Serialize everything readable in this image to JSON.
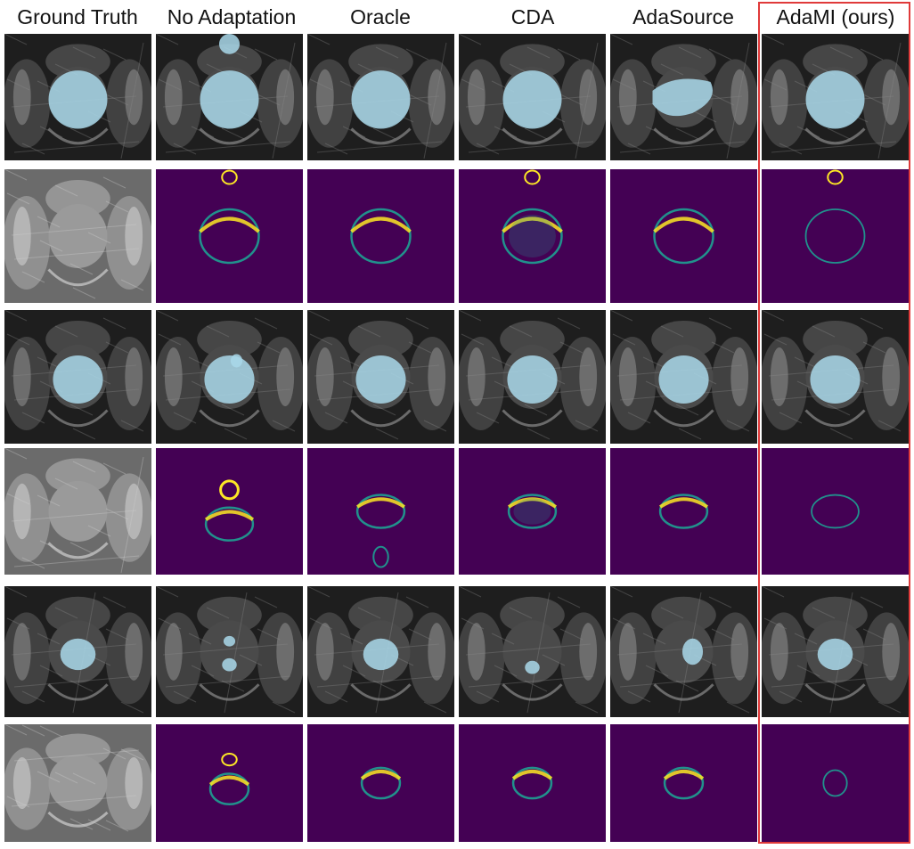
{
  "figure": {
    "columns": [
      "Ground Truth",
      "No Adaptation",
      "Oracle",
      "CDA",
      "AdaSource",
      "AdaMI (ours)"
    ],
    "highlighted_column": "AdaMI (ours)",
    "rows": [
      "segmentation",
      "entropy-map",
      "segmentation",
      "entropy-map",
      "segmentation",
      "entropy-map"
    ],
    "colors": {
      "highlight_box": "#e03a3a",
      "mask_overlay": "#a9d8ea",
      "entropy_background": "#440154",
      "entropy_high": "#fde725",
      "entropy_mid": "#21918c"
    }
  }
}
